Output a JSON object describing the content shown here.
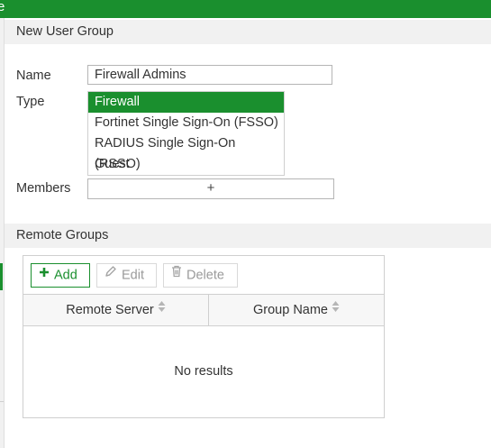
{
  "topbar": {
    "partial_glyph": "e",
    "color": "#1a8f2e"
  },
  "new_user_group": {
    "title": "New User Group",
    "name_label": "Name",
    "name_value": "Firewall Admins",
    "type_label": "Type",
    "type_options": [
      {
        "label": "Firewall",
        "selected": true
      },
      {
        "label": "Fortinet Single Sign-On (FSSO)",
        "selected": false
      },
      {
        "label": "RADIUS Single Sign-On (RSSO)",
        "selected": false
      },
      {
        "label": "Guest",
        "selected": false
      }
    ],
    "members_label": "Members",
    "members_add_symbol": "+"
  },
  "remote_groups": {
    "title": "Remote Groups",
    "toolbar": {
      "add_label": "Add",
      "edit_label": "Edit",
      "delete_label": "Delete"
    },
    "columns": [
      {
        "label": "Remote Server",
        "icon": "sort-icon"
      },
      {
        "label": "Group Name",
        "icon": "sort-icon"
      }
    ],
    "empty_message": "No results"
  },
  "colors": {
    "accent": "#1a8f2e",
    "disabled_text": "#9a9a9a",
    "header_bg": "#f1f1f1"
  }
}
